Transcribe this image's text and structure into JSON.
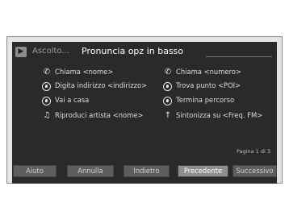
{
  "header": {
    "listening": "Ascolto...",
    "prompt": "Pronuncia opz in basso"
  },
  "commands": [
    {
      "label": "Chiama <nome>",
      "icon": "phone-icon"
    },
    {
      "label": "Chiama <numero>",
      "icon": "phone-icon"
    },
    {
      "label": "Digita indirizzo <indirizzo>",
      "icon": "navigation-icon"
    },
    {
      "label": "Trova punto <POI>",
      "icon": "navigation-icon"
    },
    {
      "label": "Vai a casa",
      "icon": "navigation-icon"
    },
    {
      "label": "Termina percorso",
      "icon": "navigation-icon"
    },
    {
      "label": "Riproduci artista <nome>",
      "icon": "music-note-icon"
    },
    {
      "label": "Sintonizza su <Freq. FM>",
      "icon": "radio-antenna-icon"
    }
  ],
  "page_indicator": "Pagina 1 di 3",
  "buttons": {
    "help": "Aiuto",
    "cancel": "Annulla",
    "back": "Indietro",
    "previous": "Precedente",
    "next": "Successivo"
  }
}
